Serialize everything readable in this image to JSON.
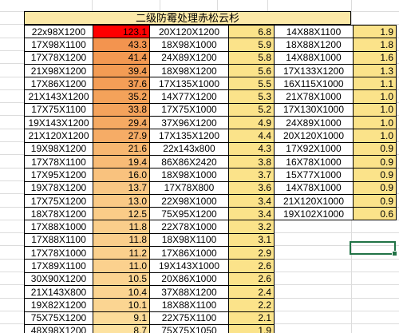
{
  "title": "二级防霉处理赤松云杉",
  "colors": {
    "header_fill": "#fce9a8",
    "value_fill": "#fbe38a",
    "heat_high": "#ff0000",
    "heat_low": "#fde2a0",
    "selection": "#217346"
  },
  "columns": [
    {
      "rows": [
        {
          "size": "22x98X1200",
          "value": "123.1"
        },
        {
          "size": "17X98X1100",
          "value": "43.3"
        },
        {
          "size": "17X78X1200",
          "value": "41.4"
        },
        {
          "size": "21X98X1200",
          "value": "39.4"
        },
        {
          "size": "17X86X1200",
          "value": "37.6"
        },
        {
          "size": "21X143X1200",
          "value": "35.2"
        },
        {
          "size": "17X75X1100",
          "value": "33.8"
        },
        {
          "size": "19X143X1200",
          "value": "29.4"
        },
        {
          "size": "21X120X1200",
          "value": "27.9"
        },
        {
          "size": "19X98X1200",
          "value": "21.6"
        },
        {
          "size": "17X78X1100",
          "value": "19.4"
        },
        {
          "size": "17X95X1200",
          "value": "16.0"
        },
        {
          "size": "19X78X1200",
          "value": "13.7"
        },
        {
          "size": "17X75X1200",
          "value": "13.0"
        },
        {
          "size": "18X78X1200",
          "value": "12.5"
        },
        {
          "size": "17X88X1000",
          "value": "11.8"
        },
        {
          "size": "17X88X1100",
          "value": "11.8"
        },
        {
          "size": "17X78X1000",
          "value": "11.2"
        },
        {
          "size": "17X89X1100",
          "value": "11.0"
        },
        {
          "size": "30X90X1200",
          "value": "10.5"
        },
        {
          "size": "21X143X800",
          "value": "10.4"
        },
        {
          "size": "19X82X1200",
          "value": "10.1"
        },
        {
          "size": "75X75X1200",
          "value": "9.1"
        },
        {
          "size": "48X98X1200",
          "value": "8.7"
        }
      ]
    },
    {
      "rows": [
        {
          "size": "20X120X1200",
          "value": "6.8"
        },
        {
          "size": "18X98X1000",
          "value": "5.9"
        },
        {
          "size": "24X89X1200",
          "value": "5.8"
        },
        {
          "size": "18X98X1200",
          "value": "5.6"
        },
        {
          "size": "17X135X1000",
          "value": "5.5"
        },
        {
          "size": "14X77X1200",
          "value": "5.3"
        },
        {
          "size": "17X75X1000",
          "value": "5.2"
        },
        {
          "size": "37X96X1200",
          "value": "4.9"
        },
        {
          "size": "17X135X1200",
          "value": "4.4"
        },
        {
          "size": "22x143x800",
          "value": "4.3"
        },
        {
          "size": "86X86X2420",
          "value": "3.8"
        },
        {
          "size": "18X98X1000",
          "value": "3.7"
        },
        {
          "size": "17X78X800",
          "value": "3.6"
        },
        {
          "size": "22X98X1000",
          "value": "3.4"
        },
        {
          "size": "75X95X1200",
          "value": "3.4"
        },
        {
          "size": "22X78X1000",
          "value": "3.2"
        },
        {
          "size": "18X98X1100",
          "value": "3.1"
        },
        {
          "size": "17X86X1000",
          "value": "2.9"
        },
        {
          "size": "19X143X1000",
          "value": "2.6"
        },
        {
          "size": "20X86X1000",
          "value": "2.6"
        },
        {
          "size": "37X88X1200",
          "value": "2.4"
        },
        {
          "size": "18X88X1100",
          "value": "2.2"
        },
        {
          "size": "22X75X1100",
          "value": "2.1"
        },
        {
          "size": "75X75X1050",
          "value": "1.9"
        }
      ]
    },
    {
      "rows": [
        {
          "size": "14X88X1100",
          "value": "1.9"
        },
        {
          "size": "18X88X1200",
          "value": "1.8"
        },
        {
          "size": "14X88X1000",
          "value": "1.6"
        },
        {
          "size": "17X133X1200",
          "value": "1.3"
        },
        {
          "size": "16X115X1000",
          "value": "1.1"
        },
        {
          "size": "21X78X1000",
          "value": "1.0"
        },
        {
          "size": "17X130X1000",
          "value": "1.0"
        },
        {
          "size": "24X89X1000",
          "value": "1.0"
        },
        {
          "size": "20X120X1000",
          "value": "1.0"
        },
        {
          "size": "17X92X1000",
          "value": "0.9"
        },
        {
          "size": "16X78X1000",
          "value": "0.9"
        },
        {
          "size": "15X77X1000",
          "value": "0.9"
        },
        {
          "size": "14X78X1000",
          "value": "0.9"
        },
        {
          "size": "21X120X1000",
          "value": "0.9"
        },
        {
          "size": "19X102X1000",
          "value": "0.6"
        }
      ]
    }
  ]
}
